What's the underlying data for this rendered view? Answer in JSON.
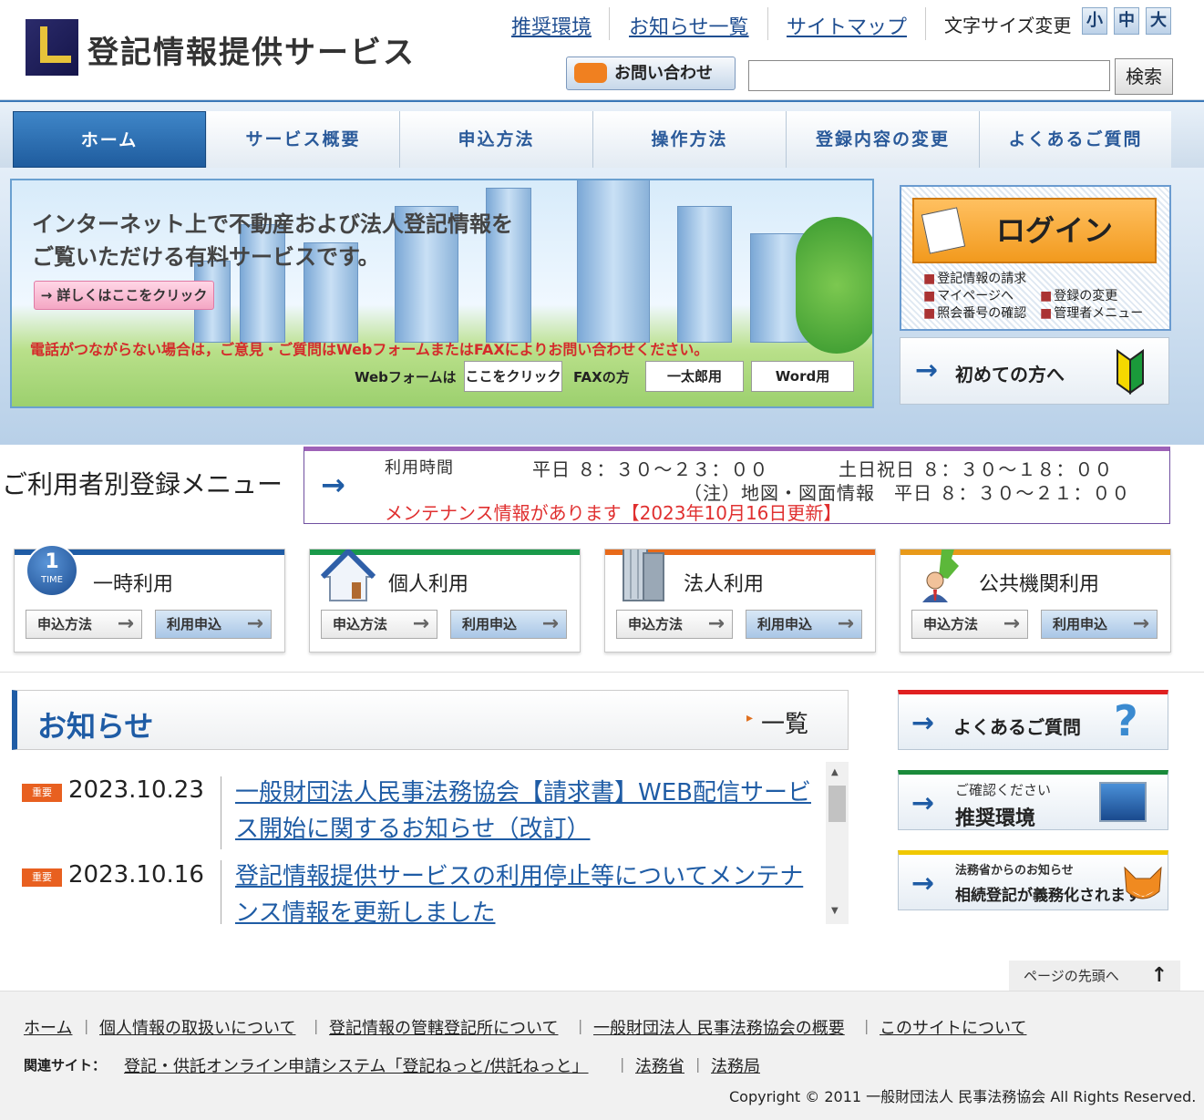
{
  "header": {
    "site_title": "登記情報提供サービス",
    "top_links": [
      "推奨環境",
      "お知らせ一覧",
      "サイトマップ"
    ],
    "font_size_label": "文字サイズ変更",
    "font_sizes": [
      "小",
      "中",
      "大"
    ],
    "contact_label": "お問い合わせ",
    "search_value": "",
    "search_button": "検索"
  },
  "gnav": [
    "ホーム",
    "サービス概要",
    "申込方法",
    "操作方法",
    "登録内容の変更",
    "よくあるご質問"
  ],
  "hero": {
    "line1": "インターネット上で不動産および法人登記情報を",
    "line2": "ご覧いただける有料サービスです。",
    "detail_button": "→ 詳しくはここをクリック",
    "notice": "電話がつながらない場合は，ご意見・ご質問はWebフォームまたはFAXによりお問い合わせください。",
    "web_label": "Webフォームは",
    "web_button": "ここをクリック",
    "fax_label": "FAXの方",
    "fax_button_1": "一太郎用",
    "fax_button_2": "Word用"
  },
  "login": {
    "button": "ログイン",
    "links": [
      "登記情報の請求",
      "マイページへ",
      "登録の変更",
      "照会番号の確認",
      "管理者メニュー"
    ],
    "first_time": "初めての方へ"
  },
  "registration": {
    "title": "ご利用者別登録メニュー",
    "hours_label": "利用時間",
    "weekday": "平日 ８：３０～２３：００",
    "weekend": "土日祝日 ８：３０～１８：００",
    "map_note": "（注）地図・図面情報　平日 ８：３０～２１：００",
    "maintenance": "メンテナンス情報があります【2023年10月16日更新】",
    "cards": [
      {
        "title": "一時利用",
        "icon_text": "1",
        "icon_sub": "TIME",
        "btn_a": "申込方法",
        "btn_b": "利用申込",
        "color": "#1f5ca5"
      },
      {
        "title": "個人利用",
        "btn_a": "申込方法",
        "btn_b": "利用申込",
        "color": "#1a9a4a"
      },
      {
        "title": "法人利用",
        "btn_a": "申込方法",
        "btn_b": "利用申込",
        "color": "#e86a1a"
      },
      {
        "title": "公共機関利用",
        "btn_a": "申込方法",
        "btn_b": "利用申込",
        "color": "#e89a1a"
      }
    ]
  },
  "news": {
    "title": "お知らせ",
    "all_label": "一覧",
    "items": [
      {
        "badge": "重要",
        "date": "2023.10.23",
        "text": "一般財団法人民事法務協会【請求書】WEB配信サービス開始に関するお知らせ（改訂）"
      },
      {
        "badge": "重要",
        "date": "2023.10.16",
        "text": "登記情報提供サービスの利用停止等についてメンテナンス情報を更新しました"
      }
    ]
  },
  "side": {
    "faq": "よくあるご質問",
    "env_small": "ご確認ください",
    "env": "推奨環境",
    "moj_small": "法務省からのお知らせ",
    "moj": "相続登記が義務化されます"
  },
  "pagetop": "ページの先頭へ",
  "footer": {
    "links": [
      "ホーム",
      "個人情報の取扱いについて",
      "登記情報の管轄登記所について",
      "一般財団法人 民事法務協会の概要",
      "このサイトについて"
    ],
    "related_label": "関連サイト：",
    "related": [
      "登記・供託オンライン申請システム「登記ねっと/供託ねっと」",
      "法務省",
      "法務局"
    ],
    "copyright": "Copyright © 2011 一般財団法人 民事法務協会 All Rights Reserved."
  }
}
